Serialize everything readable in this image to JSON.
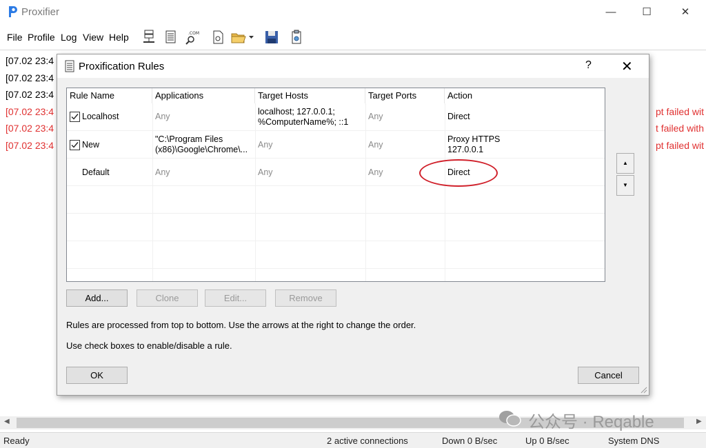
{
  "window": {
    "title": "Proxifier",
    "minimize": "—",
    "maximize": "☐",
    "close": "✕"
  },
  "menu": [
    "File",
    "Profile",
    "Log",
    "View",
    "Help"
  ],
  "log": {
    "lines": [
      {
        "text": "[07.02 23:4",
        "level": "ok"
      },
      {
        "text": "[07.02 23:4",
        "level": "ok"
      },
      {
        "text": "[07.02 23:4",
        "level": "ok"
      },
      {
        "text": "[07.02 23:4",
        "level": "err"
      },
      {
        "text": "[07.02 23:4",
        "level": "err"
      },
      {
        "text": "[07.02 23:4",
        "level": "err"
      }
    ],
    "right_fragments": [
      "pt failed wit",
      "t failed with",
      "pt failed wit"
    ]
  },
  "status": {
    "ready": "Ready",
    "connections": "2 active connections",
    "down": "Down 0 B/sec",
    "up": "Up 0 B/sec",
    "dns": "System DNS"
  },
  "watermark": "公众号 · Reqable",
  "dialog": {
    "title": "Proxification Rules",
    "help": "?",
    "close": "✕",
    "columns": [
      "Rule Name",
      "Applications",
      "Target Hosts",
      "Target Ports",
      "Action"
    ],
    "rules": [
      {
        "checked": true,
        "name": "Localhost",
        "applications": "Any",
        "target_hosts": [
          "localhost; 127.0.0.1;",
          "%ComputerName%; ::1"
        ],
        "target_ports": "Any",
        "action": [
          "Direct"
        ]
      },
      {
        "checked": true,
        "name": "New",
        "applications_lines": [
          "\"C:\\Program Files",
          "(x86)\\Google\\Chrome\\..."
        ],
        "target_hosts": [
          "Any"
        ],
        "target_ports": "Any",
        "action": [
          "Proxy HTTPS",
          "127.0.0.1"
        ]
      },
      {
        "checked": false,
        "name": "Default",
        "applications": "Any",
        "target_hosts": [
          "Any"
        ],
        "target_ports": "Any",
        "action": [
          "Direct"
        ]
      }
    ],
    "buttons": {
      "add": "Add...",
      "clone": "Clone",
      "edit": "Edit...",
      "remove": "Remove",
      "ok": "OK",
      "cancel": "Cancel"
    },
    "move_up": "▲",
    "move_down": "▼",
    "info1": "Rules are processed from top to bottom. Use the arrows at the right to change the order.",
    "info2": "Use check boxes to enable/disable a rule.",
    "highlight_color": "#d0202a"
  }
}
